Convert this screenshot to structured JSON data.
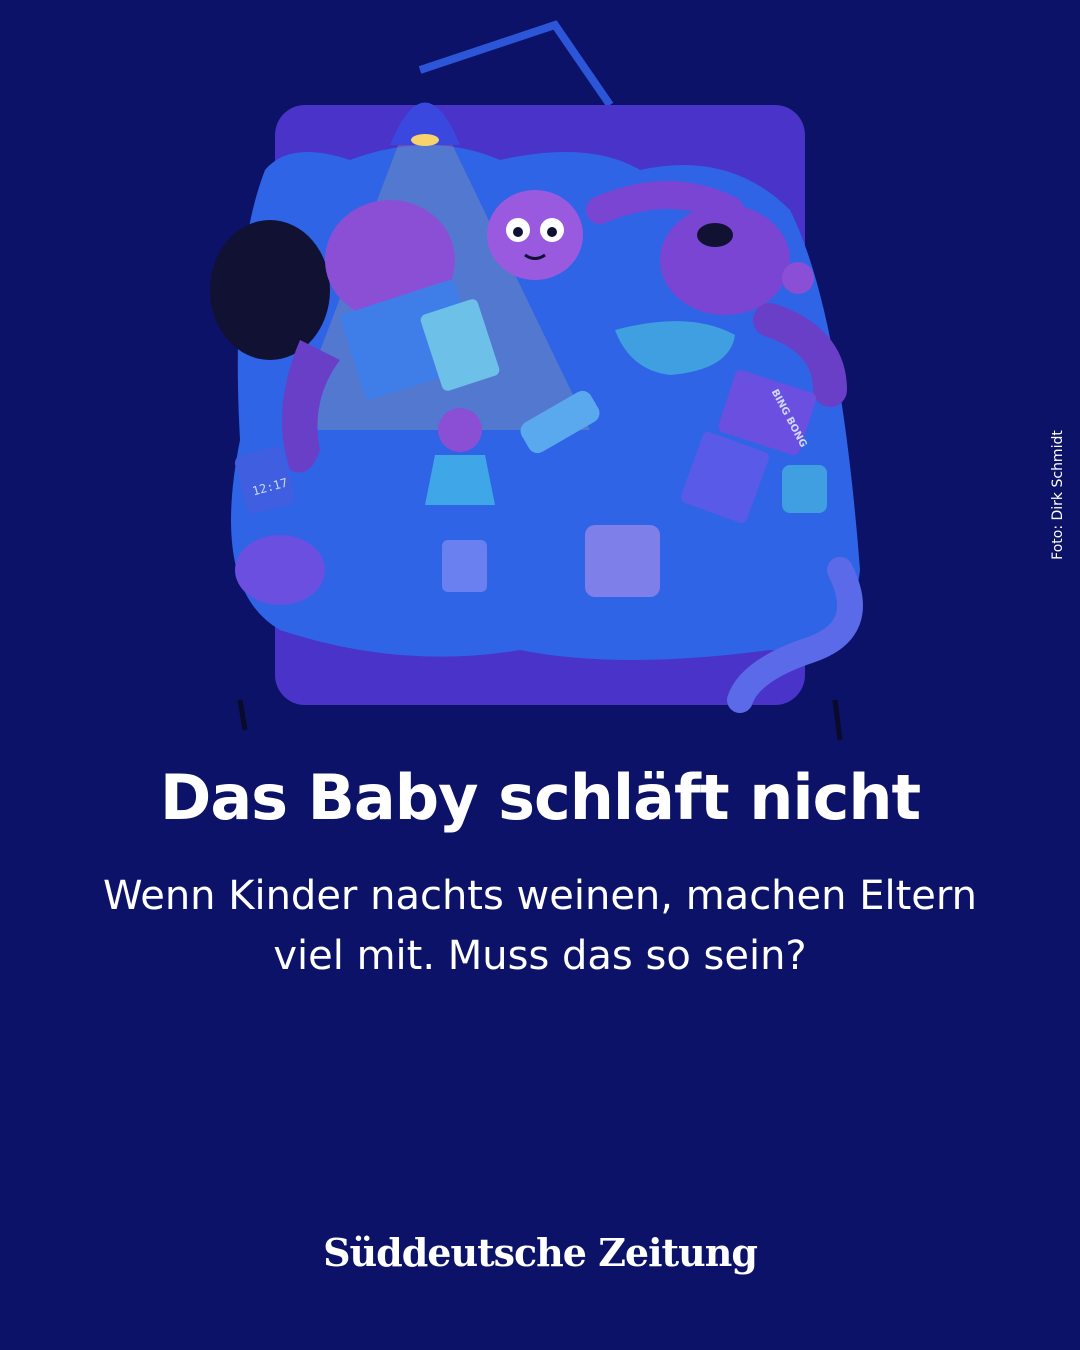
{
  "post": {
    "photo_credit": "Foto: Dirk Schmidt",
    "headline": "Das Baby schläft nicht",
    "subline": "Wenn Kinder nachts weinen, machen Eltern viel mit. Muss das so sein?",
    "brand": "Süddeutsche Zeitung"
  },
  "illustration": {
    "alarm_clock_time": "12:17",
    "book_title": "BING BONG"
  },
  "colors": {
    "background": "#0b1268",
    "bed": "#4a33c9",
    "blanket": "#2f64e6",
    "skin": "#8b4fd6",
    "lamp_light": "#f7d36b",
    "text": "#ffffff"
  }
}
